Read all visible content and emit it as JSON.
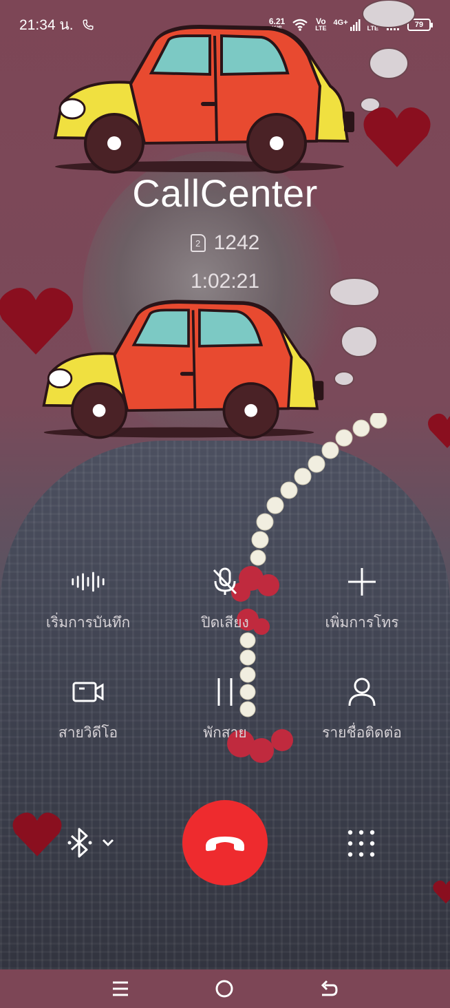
{
  "status_bar": {
    "time": "21:34 น.",
    "net_speed_value": "6.21",
    "net_speed_unit": "K/S",
    "volte1_top": "Vo",
    "volte1_bottom": "LTE",
    "network_type": "4G+",
    "volte2_top": "Vo",
    "volte2_bottom": "LTE",
    "battery_level": "79"
  },
  "caller": {
    "name": "CallCenter",
    "sim": "2",
    "number": "1242",
    "duration": "1:02:21"
  },
  "actions": {
    "record": "เริ่มการบันทึก",
    "mute": "ปิดเสียง",
    "add_call": "เพิ่มการโทร",
    "video_call": "สายวิดีโอ",
    "hold": "พักสาย",
    "contacts": "รายชื่อติดต่อ"
  },
  "colors": {
    "end_call": "#ee2b2e",
    "background": "#7d4656"
  }
}
